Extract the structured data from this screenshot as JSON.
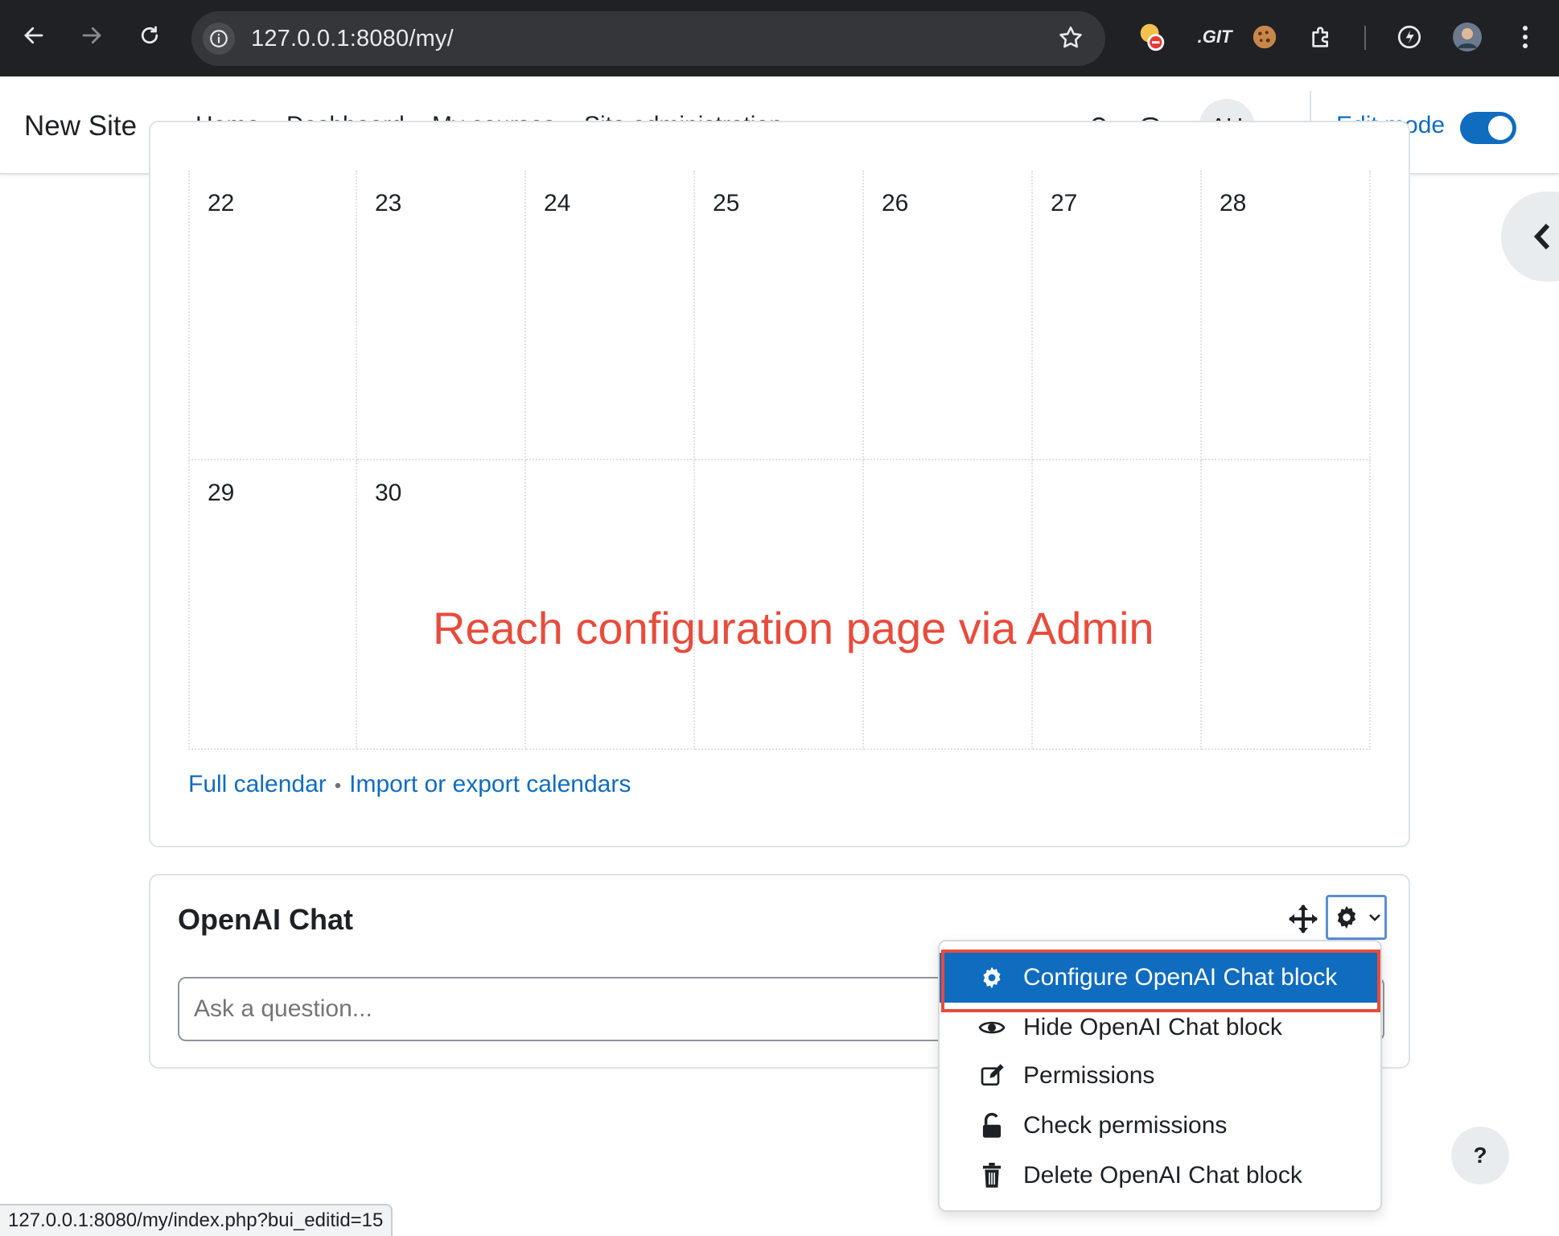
{
  "browser": {
    "url": "127.0.0.1:8080/my/",
    "ext_git_label": ".GIT"
  },
  "navbar": {
    "brand": "New Site",
    "items": [
      "Home",
      "Dashboard",
      "My courses",
      "Site administration"
    ],
    "active_item": "Dashboard",
    "avatar_initials": "AU",
    "edit_mode_label": "Edit mode",
    "edit_mode_on": true,
    "accent_color": "#0f6cbf"
  },
  "calendar": {
    "week_row_1": [
      "22",
      "23",
      "24",
      "25",
      "26",
      "27",
      "28"
    ],
    "week_row_2": [
      "29",
      "30",
      "",
      "",
      "",
      "",
      ""
    ],
    "links": {
      "full_calendar": "Full calendar",
      "separator": "•",
      "import_export": "Import or export calendars"
    }
  },
  "annotation": {
    "text": "Reach configuration page via Admin",
    "color": "#e74c3c"
  },
  "openai_block": {
    "title": "OpenAI Chat",
    "input_placeholder": "Ask a question...",
    "menu": [
      {
        "label": "Configure OpenAI Chat block",
        "icon": "gear-icon",
        "highlighted": true
      },
      {
        "label": "Hide OpenAI Chat block",
        "icon": "eye-icon",
        "highlighted": false
      },
      {
        "label": "Permissions",
        "icon": "edit-icon",
        "highlighted": false
      },
      {
        "label": "Check permissions",
        "icon": "unlock-icon",
        "highlighted": false
      },
      {
        "label": "Delete OpenAI Chat block",
        "icon": "trash-icon",
        "highlighted": false
      }
    ]
  },
  "status_bar": {
    "url": "127.0.0.1:8080/my/index.php?bui_editid=15"
  },
  "help_button": "?"
}
